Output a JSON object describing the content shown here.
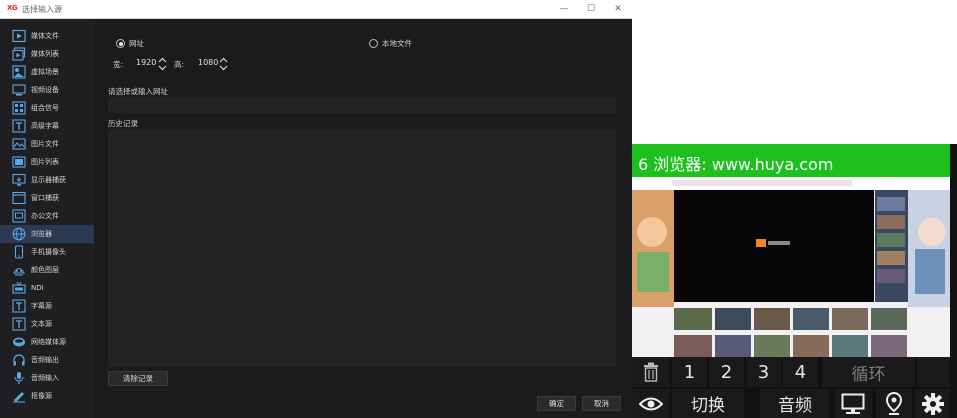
{
  "window": {
    "logo": "XG",
    "title": "选择输入源",
    "minimize": "—",
    "maximize": "☐",
    "close": "✕"
  },
  "sidebar": {
    "items": [
      {
        "label": "媒体文件",
        "icon": "play-file-icon"
      },
      {
        "label": "媒体列表",
        "icon": "media-list-icon"
      },
      {
        "label": "虚拟场景",
        "icon": "virtual-scene-icon"
      },
      {
        "label": "视频设备",
        "icon": "video-device-icon"
      },
      {
        "label": "组合信号",
        "icon": "combined-signal-icon"
      },
      {
        "label": "高级字幕",
        "icon": "advanced-caption-icon"
      },
      {
        "label": "图片文件",
        "icon": "image-file-icon"
      },
      {
        "label": "图片列表",
        "icon": "image-list-icon"
      },
      {
        "label": "显示器捕获",
        "icon": "monitor-capture-icon"
      },
      {
        "label": "窗口捕获",
        "icon": "window-capture-icon"
      },
      {
        "label": "办公文件",
        "icon": "office-file-icon"
      },
      {
        "label": "浏览器",
        "icon": "browser-globe-icon"
      },
      {
        "label": "手机摄像头",
        "icon": "phone-camera-icon"
      },
      {
        "label": "颜色图层",
        "icon": "color-layer-icon"
      },
      {
        "label": "NDI",
        "icon": "ndi-icon"
      },
      {
        "label": "字幕源",
        "icon": "caption-source-icon"
      },
      {
        "label": "文本源",
        "icon": "text-source-icon"
      },
      {
        "label": "网络媒体源",
        "icon": "network-media-icon"
      },
      {
        "label": "音频输出",
        "icon": "headphones-icon"
      },
      {
        "label": "音频输入",
        "icon": "microphone-icon"
      },
      {
        "label": "抠像源",
        "icon": "keying-source-icon"
      }
    ],
    "selected": "浏览器"
  },
  "form": {
    "radio_url": "网址",
    "radio_local": "本地文件",
    "selected_source": "网址",
    "width_label": "宽:",
    "width_value": "1920",
    "height_label": "高:",
    "height_value": "1080",
    "url_label": "请选择或输入网址",
    "url_value": "",
    "history_label": "历史记录",
    "clear_button": "清除记录",
    "ok_button": "确定",
    "cancel_button": "取消"
  },
  "preview_panel": {
    "title": "6 浏览器: www.huya.com",
    "header_color": "#1ec01e",
    "controls": {
      "delete_icon": "trash-icon",
      "buttons": [
        "1",
        "2",
        "3",
        "4"
      ],
      "loop": "循环",
      "eye_icon": "eye-icon",
      "switch": "切换",
      "audio": "音频",
      "monitor_icon": "monitor-icon",
      "location_icon": "location-pin-icon",
      "settings_icon": "gear-icon"
    }
  }
}
